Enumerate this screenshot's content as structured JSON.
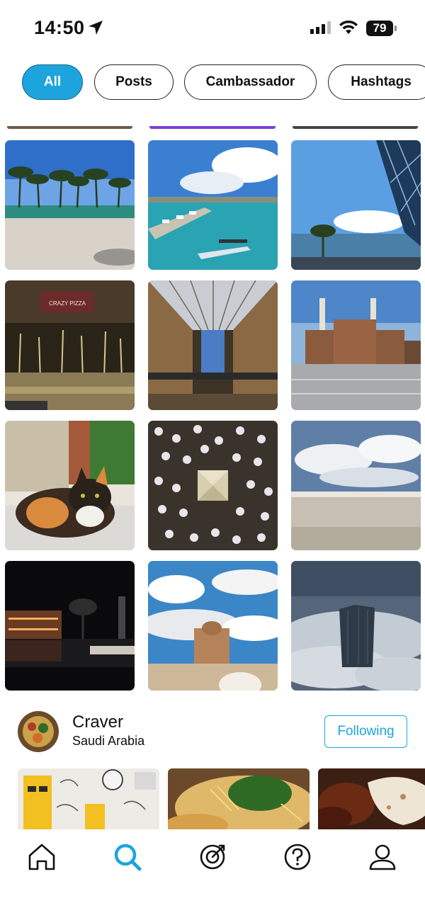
{
  "status_bar": {
    "time": "14:50",
    "battery": "79",
    "icons": [
      "location-arrow-icon",
      "cellular-signal-icon",
      "wifi-icon",
      "battery-icon"
    ]
  },
  "filters": {
    "items": [
      {
        "label": "All",
        "active": true
      },
      {
        "label": "Posts",
        "active": false
      },
      {
        "label": "Cambassador",
        "active": false
      },
      {
        "label": "Hashtags",
        "active": false
      }
    ]
  },
  "grid": {
    "tiles": [
      {
        "subject": "palm trees by pool"
      },
      {
        "subject": "marina with seaplane"
      },
      {
        "subject": "waterfront with lattice tower"
      },
      {
        "subject": "fountain plaza with pizza shop"
      },
      {
        "subject": "glass-roofed arcade"
      },
      {
        "subject": "power station with chimneys"
      },
      {
        "subject": "calico cat"
      },
      {
        "subject": "aerial crowd around pyramid"
      },
      {
        "subject": "beach and clouds"
      },
      {
        "subject": "night reflection pool"
      },
      {
        "subject": "mosque tower and clouds"
      },
      {
        "subject": "skyscraper above clouds"
      }
    ]
  },
  "profile": {
    "name": "Craver",
    "country": "Saudi Arabia",
    "follow_label": "Following"
  },
  "tabbar": {
    "items": [
      {
        "icon": "home-icon",
        "active": false
      },
      {
        "icon": "search-icon",
        "active": true
      },
      {
        "icon": "target-icon",
        "active": false
      },
      {
        "icon": "help-icon",
        "active": false
      },
      {
        "icon": "profile-icon",
        "active": false
      }
    ]
  },
  "colors": {
    "accent": "#1ea4dd",
    "text": "#111111",
    "background": "#ffffff"
  }
}
